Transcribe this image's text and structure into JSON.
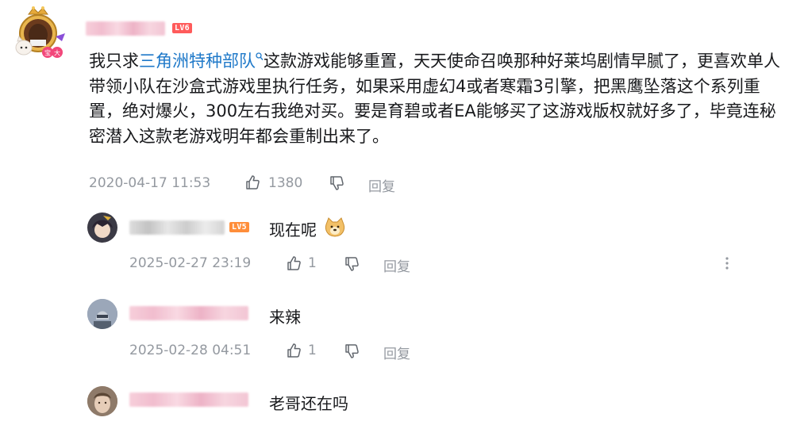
{
  "comment": {
    "level": "LV6",
    "text_before": "我只求",
    "highlight": "三角洲特种部队",
    "text_after": "这款游戏能够重置，天天使命召唤那种好莱坞剧情早腻了，更喜欢单人带领小队在沙盒式游戏里执行任务，如果采用虚幻4或者寒霜3引擎，把黑鹰坠落这个系列重置，绝对爆火，300左右我绝对买。要是育碧或者EA能够买了这游戏版权就好多了，毕竟连秘密潜入这款老游戏明年都会重制出来了。",
    "time": "2020-04-17 11:53",
    "likes": "1380",
    "reply_label": "回复"
  },
  "replies": [
    {
      "level": "LV5",
      "text": "现在呢",
      "emoji": "doge-emoji",
      "time": "2025-02-27 23:19",
      "likes": "1",
      "reply_label": "回复"
    },
    {
      "level": "",
      "text": "来辣",
      "time": "2025-02-28 04:51",
      "likes": "1",
      "reply_label": "回复"
    },
    {
      "level": "",
      "text": "老哥还在吗"
    }
  ],
  "icons": [
    "avatar-frame",
    "search-icon",
    "thumb-up-icon",
    "thumb-down-icon",
    "more-options-icon"
  ],
  "colors": {
    "link": "#1f79c9",
    "meta": "#9499a0",
    "lv6": "#ff5b5b",
    "lv5": "#ff8e3a"
  }
}
